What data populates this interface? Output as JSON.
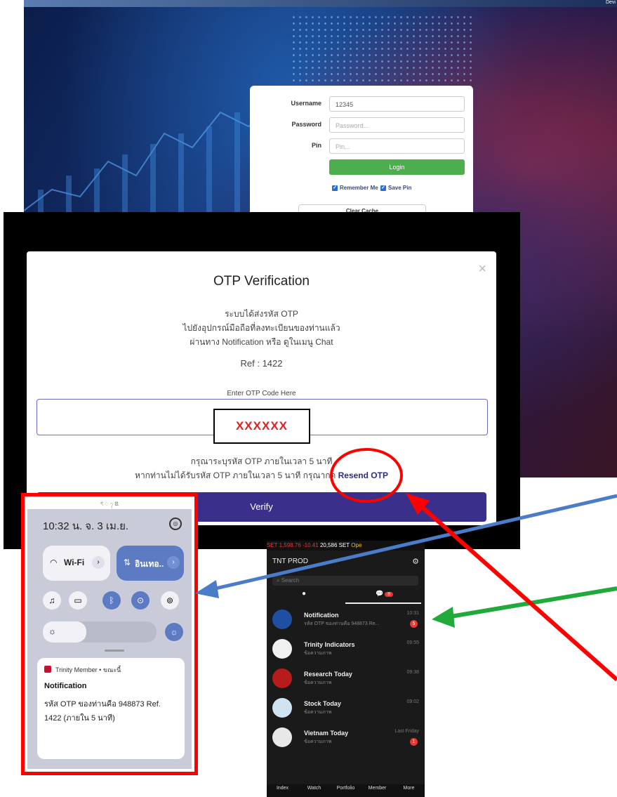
{
  "login": {
    "dev_label": "Devi",
    "username_label": "Username",
    "username_value": "12345",
    "password_label": "Password",
    "password_placeholder": "Password...",
    "pin_label": "Pin",
    "pin_placeholder": "Pin...",
    "login_button": "Login",
    "remember_me": "Remember Me",
    "save_pin": "Save Pin",
    "clear_cache": "Clear Cache"
  },
  "otp": {
    "title": "OTP Verification",
    "line1": "ระบบได้ส่งรหัส OTP",
    "line2": "ไปยังอุปกรณ์มือถือที่ลงทะเบียนของท่านแล้ว",
    "line3": "ผ่านทาง Notification หรือ ดูในเมนู Chat",
    "ref": "Ref :  1422",
    "enter_label": "Enter OTP Code Here",
    "code_value": "XXXXXX",
    "hint1": "กรุณาระบุรหัส OTP ภายในเวลา 5 นาที",
    "hint2_prefix": "หากท่านไม่ได้รับรหัส OTP ภายในเวลา 5 นาที กรุณากด ",
    "resend": "Resend OTP",
    "verify": "Verify",
    "close": "×"
  },
  "android": {
    "status_icons": "ৎ ◌ ၇ ꢃ",
    "time": "10:32 น. จ. 3 เม.ย.",
    "wifi_label": "Wi-Fi",
    "internet_label": "อินเทอ..",
    "notif_app": "Trinity Member • ขณะนี้",
    "notif_title": "Notification",
    "notif_body": "รหัส OTP ของท่านคือ 948873 Ref. 1422 (ภายใน 5 นาที)"
  },
  "phone": {
    "ticker_set": "SET 1,598.76",
    "ticker_change": "-10.41",
    "ticker_volume": "20,586 SET",
    "ticker_status": "Ope",
    "header_title": "TNT PROD",
    "search_placeholder": "Search",
    "chat_badge": "8",
    "messages": [
      {
        "name": "Notification",
        "sub": "รหัส OTP ของท่านคือ 948873 Re...",
        "time": "10:31",
        "badge": "5"
      },
      {
        "name": "Trinity Indicators",
        "sub": "ข้อความภาพ",
        "time": "09:55",
        "badge": ""
      },
      {
        "name": "Research Today",
        "sub": "ข้อความภาพ",
        "time": "09:38",
        "badge": ""
      },
      {
        "name": "Stock Today",
        "sub": "ข้อความภาพ",
        "time": "09:02",
        "badge": ""
      },
      {
        "name": "Vietnam Today",
        "sub": "ข้อความภาพ",
        "time": "Last Friday",
        "badge": "1"
      }
    ],
    "nav": [
      "Index",
      "Watch",
      "Portfolio",
      "Member",
      "More"
    ]
  },
  "colors": {
    "highlight_red": "#ff0000",
    "arrow_blue": "#4a7cc9",
    "arrow_green": "#1faa3a",
    "verify_purple": "#3a2f8a",
    "login_green": "#4cae4c"
  }
}
